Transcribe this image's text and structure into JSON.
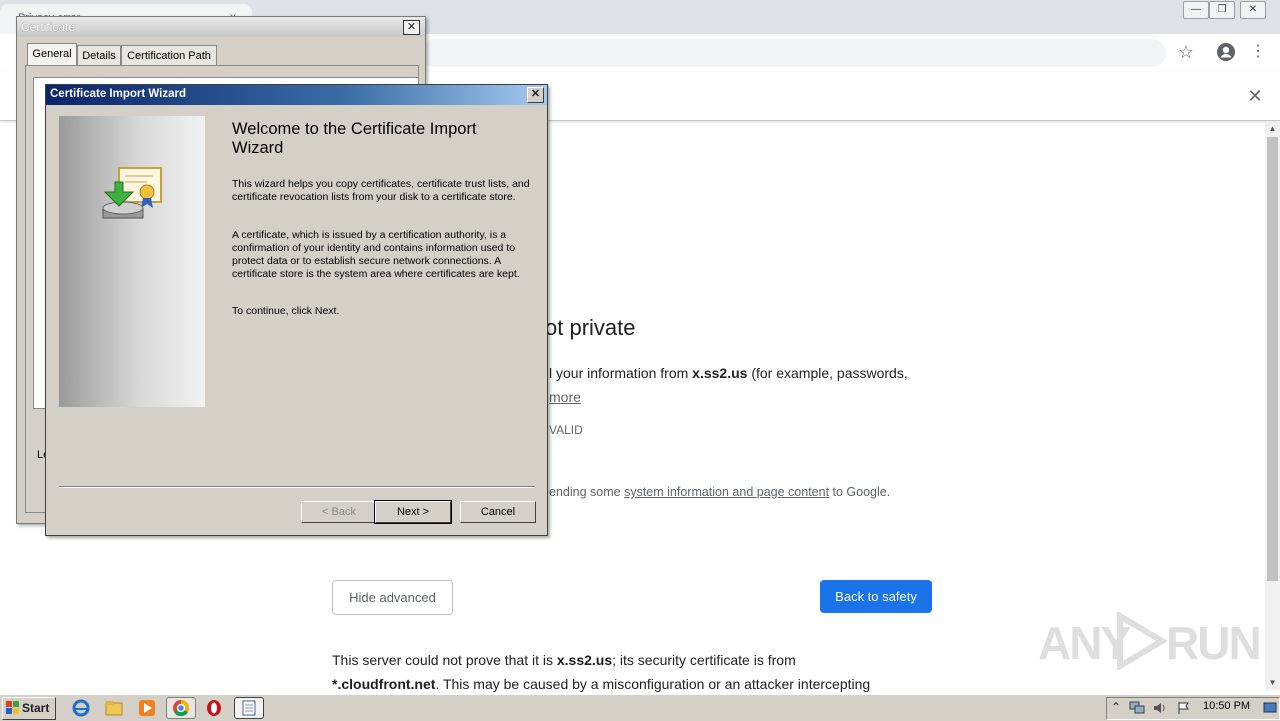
{
  "browser": {
    "tab_title": "Privacy error",
    "tab_close": "×",
    "window_buttons": [
      "—",
      "❐",
      "✕"
    ],
    "menu_glyph": "⋮",
    "star_glyph": "☆",
    "infobar_close": "✕"
  },
  "page": {
    "heading": "ot private",
    "para1_line1_a": "l your information from ",
    "para1_domain": "x.ss2.us",
    "para1_line1_b": " (for example, passwords,",
    "para1_line2": "more",
    "error_code": "VALID",
    "extended_a": "ending some ",
    "extended_link": "system information and page content",
    "extended_b": " to Google.",
    "hide_advanced": "Hide advanced",
    "back_to_safety": "Back to safety",
    "details_a": "This server could not prove that it is ",
    "details_domain": "x.ss2.us",
    "details_b": "; its security certificate is from",
    "details2_domain": "*.cloudfront.net",
    "details2_b": ". This may be caused by a misconfiguration or an attacker intercepting"
  },
  "watermark": {
    "left": "ANY",
    "right": "RUN"
  },
  "cert_dialog": {
    "title": "Certificate",
    "close": "✕",
    "tabs": [
      "General",
      "Details",
      "Certification Path"
    ],
    "learn_label": "Le"
  },
  "wizard": {
    "title": "Certificate Import Wizard",
    "close": "✕",
    "heading": "Welcome to the Certificate Import Wizard",
    "p1": "This wizard helps you copy certificates, certificate trust lists, and certificate revocation lists from your disk to a certificate store.",
    "p2": "A certificate, which is issued by a certification authority, is a confirmation of your identity and contains information used to protect data or to establish secure network connections. A certificate store is the system area where certificates are kept.",
    "p3": "To continue, click Next.",
    "back": "< Back",
    "next": "Next >",
    "cancel": "Cancel"
  },
  "taskbar": {
    "start": "Start",
    "clock": "10:50 PM",
    "icons": [
      "ie-icon",
      "explorer-icon",
      "media-player-icon",
      "chrome-icon",
      "opera-icon",
      "notepad-icon"
    ]
  }
}
